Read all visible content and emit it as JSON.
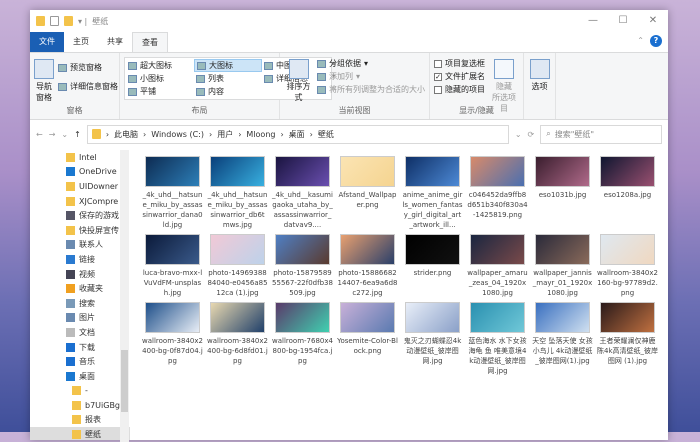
{
  "window": {
    "title": "壁纸",
    "controls": [
      "—",
      "☐",
      "✕"
    ],
    "help": "?"
  },
  "tabs": [
    "文件",
    "主页",
    "共享",
    "查看"
  ],
  "ribbon": {
    "panes": {
      "nav": "导航窗格",
      "preview": "预览窗格",
      "details": "详细信息窗格",
      "label": "窗格"
    },
    "layout": {
      "items": [
        "超大图标",
        "大图标",
        "中图标",
        "小图标",
        "列表",
        "详细信息",
        "平铺",
        "内容"
      ],
      "selected": "大图标",
      "label": "布局"
    },
    "view": {
      "sort": "排序方式",
      "group": "分组依据",
      "add_col": "添加列",
      "fit": "将所有列调整为合适的大小",
      "label": "当前视图"
    },
    "show": {
      "checkboxes": "项目复选框",
      "ext": "文件扩展名",
      "hidden": "隐藏的项目",
      "ext_checked": true,
      "hide_sel": "隐藏",
      "hide_sel2": "所选项目",
      "label": "显示/隐藏"
    },
    "options": "选项"
  },
  "address": {
    "path": [
      "此电脑",
      "Windows (C:)",
      "用户",
      "Mloong",
      "桌面",
      "壁纸"
    ],
    "search_placeholder": "搜索\"壁纸\""
  },
  "sidebar": [
    "Intel",
    "OneDrive",
    "UIDowner",
    "XJCompre",
    "保存的游戏",
    "快投屏宣传",
    "联系人",
    "链接",
    "视频",
    "收藏夹",
    "搜索",
    "图片",
    "文档",
    "下载",
    "音乐",
    "桌面",
    "-",
    "b7UiGBg",
    "报表",
    "壁纸"
  ],
  "files": [
    {
      "name": "_4k_uhd__hatsune_miku_by_assassinwarrior_dana0ld.jpg",
      "c": [
        "#0d2b52",
        "#2d7fb8"
      ]
    },
    {
      "name": "_4k_uhd__hatsune_miku_by_assassinwarrior_db6tmws.jpg",
      "c": [
        "#0a3f7a",
        "#38b0e0"
      ]
    },
    {
      "name": "_4k_uhd__kasumigaoka_utaha_by_assassinwarrior_datvav9....",
      "c": [
        "#1a1440",
        "#6a4fb0"
      ]
    },
    {
      "name": "Afstand_Wallpaper.png",
      "c": [
        "#fbe4b3",
        "#f5d490"
      ]
    },
    {
      "name": "anime_anime_girls_women_fantasy_girl_digital_art_artwork_ill...",
      "c": [
        "#0e2f66",
        "#4d8ad6"
      ]
    },
    {
      "name": "c046452da9ffb8d651b340f830a4-1425819.png",
      "c": [
        "#d88a6a",
        "#4a6fb0"
      ]
    },
    {
      "name": "eso1031b.jpg",
      "c": [
        "#3a1e2e",
        "#b06a8a"
      ]
    },
    {
      "name": "eso1208a.jpg",
      "c": [
        "#0f1630",
        "#9a5070"
      ]
    },
    {
      "name": "luca-bravo-mxx-lVuVdFM-unsplash.jpg",
      "c": [
        "#0b1a3a",
        "#3a5a8a"
      ]
    },
    {
      "name": "photo-1496938884040-e0456a8512ca (1).jpg",
      "c": [
        "#f1c9d6",
        "#bdd2ea"
      ]
    },
    {
      "name": "photo-1587958955567-22f0dfb38509.jpg",
      "c": [
        "#4f7fc4",
        "#5a3a2e"
      ]
    },
    {
      "name": "photo-1588668214407-6ea9a6d8c272.jpg",
      "c": [
        "#e8a070",
        "#2a3f6a"
      ]
    },
    {
      "name": "strider.png",
      "c": [
        "#000000",
        "#111111"
      ]
    },
    {
      "name": "wallpaper_amaru_zeas_04_1920x1080.jpg",
      "c": [
        "#1a2640",
        "#7a4a4a"
      ]
    },
    {
      "name": "wallpaper_jannis_mayr_01_1920x1080.jpg",
      "c": [
        "#2a2a3a",
        "#8a6a5a"
      ]
    },
    {
      "name": "wallroom-3840x2160-bg-97789d2.png",
      "c": [
        "#dfe8f0",
        "#f0d8c0"
      ]
    },
    {
      "name": "wallroom-3840x2400-bg-0f87d04.jpg",
      "c": [
        "#1e4f8a",
        "#e8eef6"
      ]
    },
    {
      "name": "wallroom-3840x2400-bg-6d8fd01.jpg",
      "c": [
        "#e8d8b0",
        "#20406a"
      ]
    },
    {
      "name": "wallroom-7680x4800-bg-1954fca.jpg",
      "c": [
        "#5a3a6a",
        "#40d0b0"
      ]
    },
    {
      "name": "Yosemite-Color-Block.png",
      "c": [
        "#c8b0d8",
        "#5a7ab0"
      ]
    },
    {
      "name": "鬼灭之刃蝴蝶忍4k动漫壁纸_彼岸图网.jpg",
      "c": [
        "#e8eef8",
        "#8aa0c8"
      ]
    },
    {
      "name": "蓝色海水 水下女孩 海龟 鱼 唯美意境4k动漫壁纸_彼岸图网.jpg",
      "c": [
        "#2a90b0",
        "#70c8d8"
      ]
    },
    {
      "name": "天空 坠落天使 女孩 小鸟儿 4k动漫壁纸_彼岸图网(1).jpg",
      "c": [
        "#3a70c0",
        "#d0e0f0"
      ]
    },
    {
      "name": "王者荣耀澜仅神鹿陈4k高清壁纸_彼岸图网 (1).jpg",
      "c": [
        "#2a1a1a",
        "#c07040"
      ]
    }
  ]
}
